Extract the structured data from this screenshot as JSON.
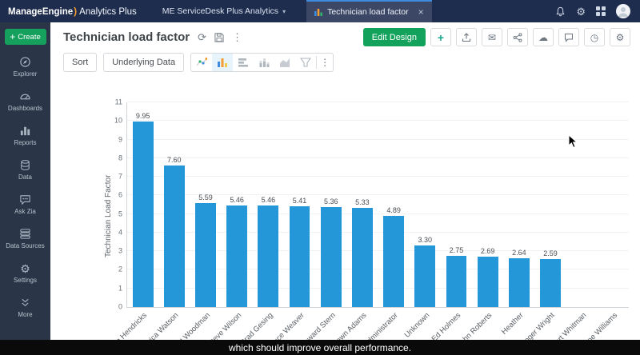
{
  "topbar": {
    "brand_manage": "ManageEngine",
    "brand_product": "Analytics Plus",
    "workspace_label": "ME ServiceDesk Plus Analytics",
    "tab_label": "Technician load factor"
  },
  "sidebar": {
    "create_label": "Create",
    "items": [
      {
        "id": "explorer",
        "label": "Explorer"
      },
      {
        "id": "dashboards",
        "label": "Dashboards"
      },
      {
        "id": "reports",
        "label": "Reports"
      },
      {
        "id": "data",
        "label": "Data"
      },
      {
        "id": "ask-zia",
        "label": "Ask Zia"
      },
      {
        "id": "data-sources",
        "label": "Data Sources"
      },
      {
        "id": "settings",
        "label": "Settings"
      },
      {
        "id": "more",
        "label": "More"
      }
    ]
  },
  "header": {
    "title": "Technician load factor",
    "edit_design_label": "Edit Design"
  },
  "toolbar": {
    "sort_label": "Sort",
    "underlying_data_label": "Underlying Data"
  },
  "icons": {
    "refresh": "⟳",
    "kebab": "⋮",
    "close": "×",
    "chevron_down": "▾",
    "plus": "+",
    "gear": "⚙",
    "mail": "✉",
    "cloud": "☁",
    "clock": "◷"
  },
  "chart_data": {
    "type": "bar",
    "title": "Technician load factor",
    "xlabel": "",
    "ylabel": "Technician Load Factor",
    "ylim": [
      0,
      11
    ],
    "grid": true,
    "legend": "none",
    "bar_color": "#2397d8",
    "categories": [
      "Lynn Hendricks",
      "Frederica Watson",
      "Robert Woodman",
      "Steve Wilson",
      "Brad Gesing",
      "Bruce Weaver",
      "Howard Stern",
      "Shawn Adams",
      "administrator",
      "Unknown",
      "Ed Holmes",
      "John Roberts",
      "Heather",
      "Roger Wright",
      "Robert Whitman",
      "Joe Williams"
    ],
    "values": [
      9.95,
      7.6,
      5.59,
      5.46,
      5.46,
      5.41,
      5.36,
      5.33,
      4.89,
      3.3,
      2.75,
      2.69,
      2.64,
      2.59,
      0,
      0
    ]
  },
  "caption": "which should improve overall performance."
}
